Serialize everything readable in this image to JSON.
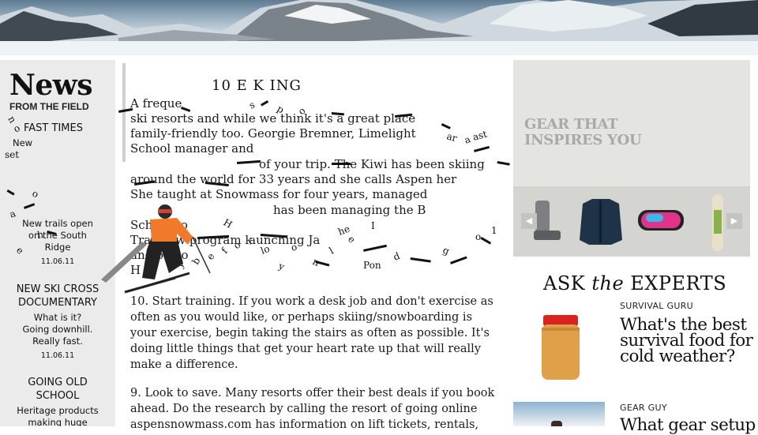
{
  "left": {
    "news_title": "News",
    "news_subtitle": "FROM THE FIELD",
    "items": [
      {
        "headline": "FAST TIMES",
        "desc": "New",
        "date": ""
      },
      {
        "headline": "",
        "desc": "New trails open on the South Ridge",
        "date": "11.06.11"
      },
      {
        "headline": "NEW SKI CROSS DOCUMENTARY",
        "desc": "What is it? Going downhill. Really fast.",
        "date": "11.06.11"
      },
      {
        "headline": "GOING OLD SCHOOL",
        "desc": "Heritage products making huge",
        "date": ""
      }
    ]
  },
  "article": {
    "heading": "10       E    K ING",
    "fragments": [
      "A       freque",
      "ski resorts and while we think it's a great place",
      "family-friendly too. Georgie Bremner, Limelight",
      "School manager and",
      "of your trip. The Kiwi has been skiing",
      "around the world for 33 years and she calls Aspen her",
      "She taught at Snowmass for four years, managed",
      "has been managing the B",
      "Sch     r two",
      "Track    ew program launching Ja",
      "and    owbo",
      "H"
    ],
    "para10": "10. Start training. If you work a desk job and don't exercise as often as you would like, or perhaps skiing/snowboarding is your exercise, begin taking the stairs as often as possible. It's doing little things that get your heart rate up that will really make a difference.",
    "para9": "9. Look to save. Many resorts offer their best deals if you book ahead. Do the research by calling the resort of going online aspensnowmass.com has information on lift tickets, rentals,"
  },
  "gear": {
    "title_line1": "GEAR THAT",
    "title_line2": "INSPIRES YOU",
    "items": [
      "ski-boot-icon",
      "jacket-icon",
      "goggles-icon",
      "snowboard-icon"
    ],
    "prev": "◀",
    "next": "▶"
  },
  "experts": {
    "title_pre": "ASK ",
    "title_em": "the",
    "title_post": " EXPERTS",
    "entries": [
      {
        "category": "SURVIVAL GURU",
        "question": "What's the best survival food for cold weather?"
      },
      {
        "category": "GEAR GUY",
        "question": "What gear setup"
      }
    ]
  },
  "colors": {
    "left_bg": "#ebebeb",
    "gear_bg": "#e4e4e0",
    "gear_title": "#a9a9a6",
    "skier_jacket": "#f07a2a"
  }
}
